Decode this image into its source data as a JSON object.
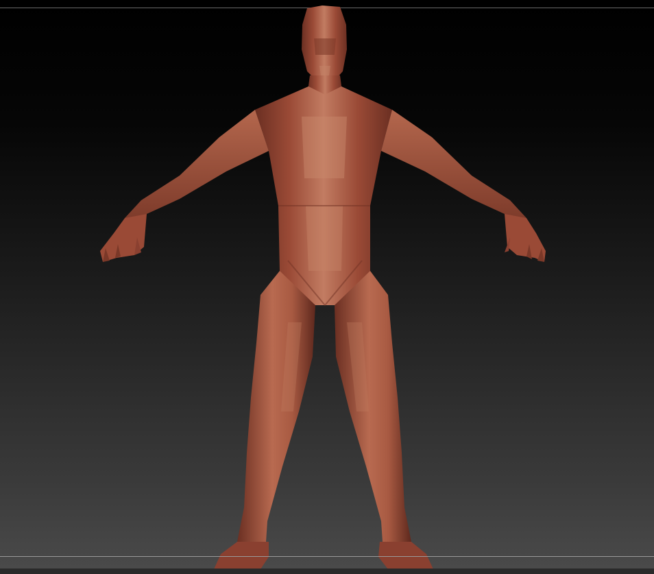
{
  "viewport": {
    "background_top": "#000000",
    "background_bottom": "#4b4b4b"
  },
  "model": {
    "name": "",
    "material_color": "#a8543f",
    "highlight_color": "#c98a70",
    "shadow_color": "#6b2f22"
  }
}
